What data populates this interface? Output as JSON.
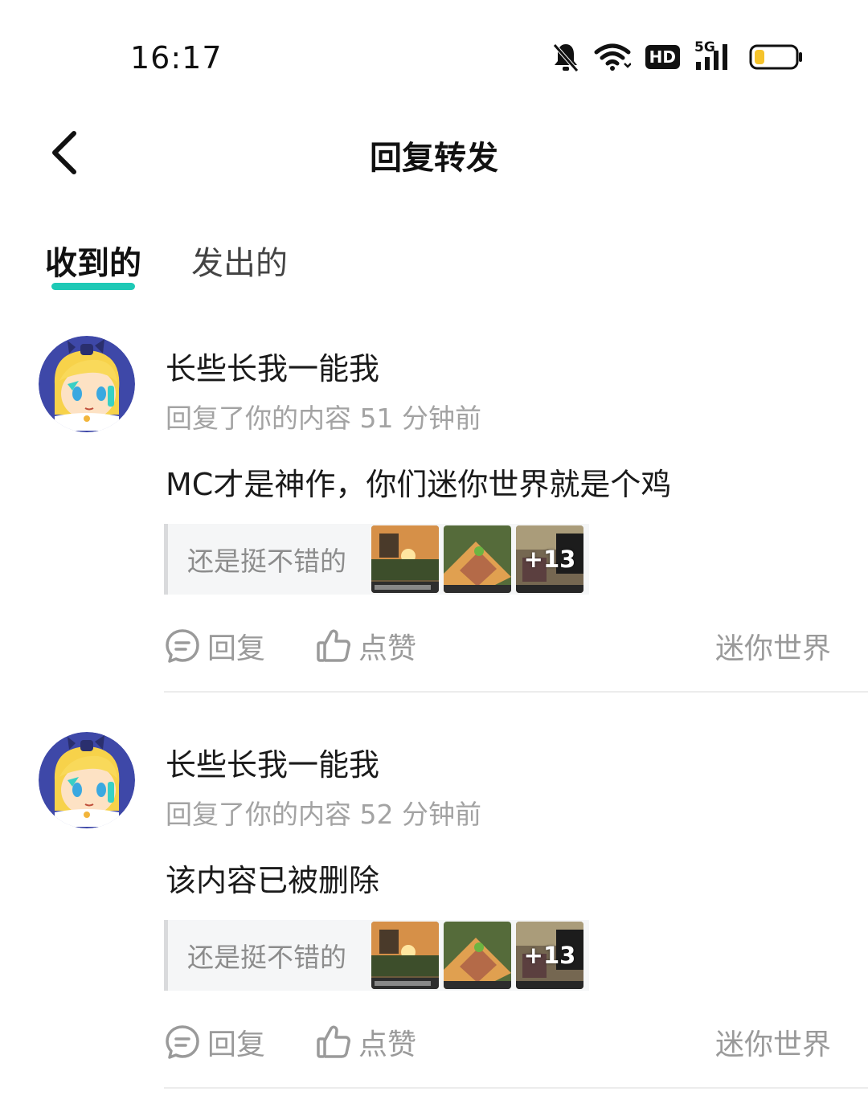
{
  "status_bar": {
    "time": "16:17",
    "hd": "HD",
    "network": "5G"
  },
  "header": {
    "title": "回复转发"
  },
  "tabs": [
    {
      "label": "收到的",
      "active": true
    },
    {
      "label": "发出的",
      "active": false
    }
  ],
  "items": [
    {
      "name": "长些长我一能我",
      "meta": "回复了你的内容 51 分钟前",
      "content": "MC才是神作，你们迷你世界就是个鸡",
      "quote": {
        "text": "还是挺不错的",
        "more_count": "+13"
      },
      "actions": {
        "reply": "回复",
        "like": "点赞",
        "source": "迷你世界"
      }
    },
    {
      "name": "长些长我一能我",
      "meta": "回复了你的内容 52 分钟前",
      "content": "该内容已被删除",
      "quote": {
        "text": "还是挺不错的",
        "more_count": "+13"
      },
      "actions": {
        "reply": "回复",
        "like": "点赞",
        "source": "迷你世界"
      }
    }
  ],
  "colors": {
    "accent": "#1ec9b6",
    "muted_text": "#a3a3a3",
    "battery_low": "#f5c32b"
  }
}
